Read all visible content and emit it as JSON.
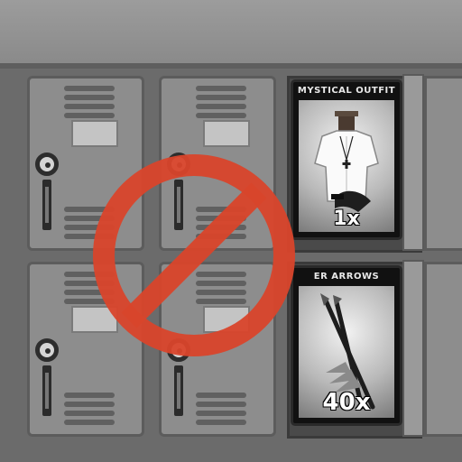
{
  "cards": [
    {
      "title": "MYSTICAL OUTFIT",
      "count": "1x",
      "icon": "outfit-icon"
    },
    {
      "title": "ER ARROWS",
      "count": "40x",
      "icon": "arrows-icon"
    }
  ],
  "overlay": {
    "icon": "prohibition-icon",
    "color": "#d9452b"
  }
}
